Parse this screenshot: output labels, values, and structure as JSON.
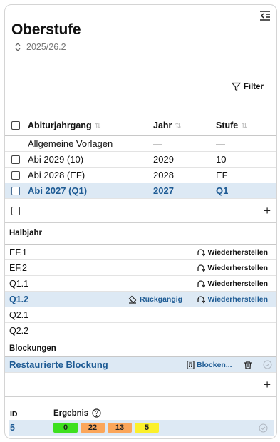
{
  "header": {
    "title": "Oberstufe",
    "school_year": "2025/26.2",
    "filter_label": "Filter"
  },
  "table": {
    "columns": [
      "Abiturjahrgang",
      "Jahr",
      "Stufe"
    ],
    "rows": [
      {
        "name": "Allgemeine Vorlagen",
        "jahr": "—",
        "stufe": "—"
      },
      {
        "name": "Abi 2029 (10)",
        "jahr": "2029",
        "stufe": "10"
      },
      {
        "name": "Abi 2028 (EF)",
        "jahr": "2028",
        "stufe": "EF"
      },
      {
        "name": "Abi 2027 (Q1)",
        "jahr": "2027",
        "stufe": "Q1",
        "selected": true
      }
    ],
    "add_label": "+"
  },
  "halbjahr": {
    "label": "Halbjahr",
    "rows": [
      {
        "name": "EF.1",
        "action": "Wiederherstellen"
      },
      {
        "name": "EF.2",
        "action": "Wiederherstellen"
      },
      {
        "name": "Q1.1",
        "action": "Wiederherstellen"
      },
      {
        "name": "Q1.2",
        "undo": "Rückgängig",
        "action": "Wiederherstellen",
        "selected": true
      },
      {
        "name": "Q2.1"
      },
      {
        "name": "Q2.2"
      }
    ]
  },
  "blockungen": {
    "label": "Blockungen",
    "name": "Restaurierte Blockung",
    "blocken_label": "Blocken...",
    "add_label": "+"
  },
  "ergebnis": {
    "id_header": "ID",
    "result_header": "Ergebnis",
    "row_id": "5",
    "badges": [
      {
        "value": "0",
        "color": "#3ee01f"
      },
      {
        "value": "22",
        "color": "#fba65a"
      },
      {
        "value": "13",
        "color": "#fba65a"
      },
      {
        "value": "5",
        "color": "#fbf02c"
      }
    ]
  },
  "colors": {
    "accent": "#1e5b94",
    "selected_bg": "#dde9f4"
  }
}
